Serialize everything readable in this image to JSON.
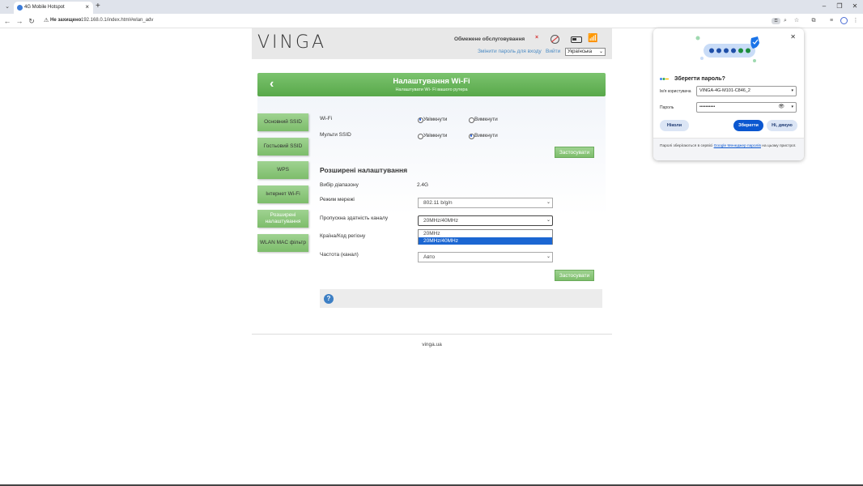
{
  "browser": {
    "tab_title": "4G Mobile Hotspot",
    "tab_close": "×",
    "new_tab": "+",
    "minimize": "–",
    "restore": "❐",
    "close": "✕",
    "security_text": "Не захищено",
    "url": "192.168.0.1/index.html#wlan_adv",
    "key_badge": "⚿",
    "icons": [
      "back-icon",
      "forward-icon",
      "reload-icon",
      "zoom-icon",
      "star-icon",
      "extensions-icon",
      "cast-icon",
      "profile-icon",
      "menu-icon"
    ]
  },
  "header": {
    "logo": "VINGA",
    "service_text": "Обмежене обслуговування",
    "service_x": "×",
    "change_password": "Змінити пароль для входу",
    "logout": "Вийти",
    "language": "Українська"
  },
  "banner": {
    "title": "Налаштування Wi-Fi",
    "subtitle": "Налаштувати Wi- Fi вашого рутера"
  },
  "sidebar": {
    "items": [
      {
        "label": "Основний SSID"
      },
      {
        "label": "Гостьовий SSID"
      },
      {
        "label": "WPS"
      },
      {
        "label": "Інтернет Wi-Fi"
      },
      {
        "label": "Розширені налаштування"
      },
      {
        "label": "WLAN MAC фільтр"
      }
    ]
  },
  "wifi_form": {
    "wifi_label": "Wi-Fi",
    "multi_ssid_label": "Мульти SSID",
    "on": "Увімкнути",
    "off": "Вимкнути",
    "wifi_state": "on",
    "multi_ssid_state": "off",
    "apply": "Застосувати"
  },
  "advanced": {
    "heading": "Розширені налаштування",
    "band_label": "Вибір діапазону",
    "band_value": "2.4G",
    "mode_label": "Режим мережі",
    "mode_value": "802.11 b/g/n",
    "bandwidth_label": "Пропускна здатність каналу",
    "bandwidth_value": "20MHz/40MHz",
    "bandwidth_options": [
      "20MHz",
      "20MHz/40MHz"
    ],
    "country_label": "Країна/Код регіону",
    "channel_label": "Частота (канал)",
    "channel_value": "Авто",
    "apply": "Застосувати"
  },
  "help": {
    "icon": "?"
  },
  "footer": {
    "text": "vinga.ua"
  },
  "password_popup": {
    "title": "Зберегти пароль?",
    "username_label": "Ім'я користувача",
    "username_value": "VINGA-4G-M101-C846_2",
    "password_label": "Пароль",
    "password_value": "••••••••••",
    "never": "Ніколи",
    "save": "Зберегти",
    "no_thanks": "Ні, дякую",
    "footer_pre": "Паролі зберігаються в сервісі ",
    "footer_link": "Google Менеджер паролів",
    "footer_post": " на цьому пристрої."
  },
  "colors": {
    "accent_green": "#7dbd6b",
    "banner_green": "#58a84a",
    "link_blue": "#4a8ac4",
    "google_blue": "#0b57d0",
    "selected_option": "#1b66d2"
  }
}
